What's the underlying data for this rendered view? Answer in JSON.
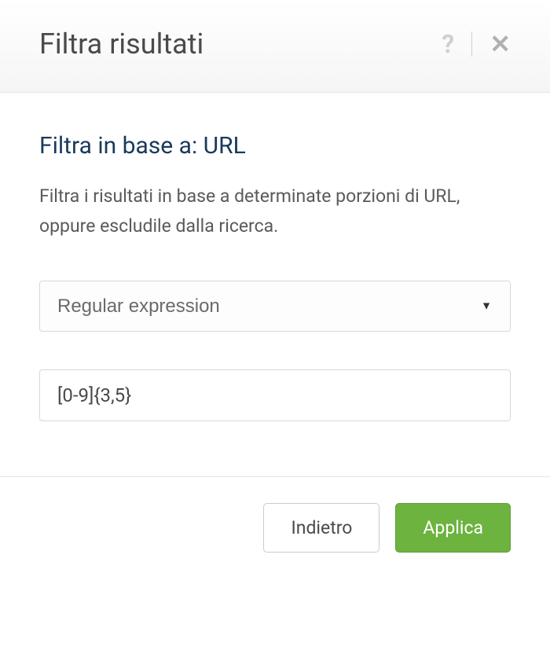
{
  "header": {
    "title": "Filtra risultati"
  },
  "body": {
    "subtitle": "Filtra in base a: URL",
    "description": "Filtra i risultati in base a determinate porzioni di URL, oppure escludile dalla ricerca.",
    "select_value": "Regular expression",
    "input_value": "[0-9]{3,5}"
  },
  "footer": {
    "back_label": "Indietro",
    "apply_label": "Applica"
  }
}
